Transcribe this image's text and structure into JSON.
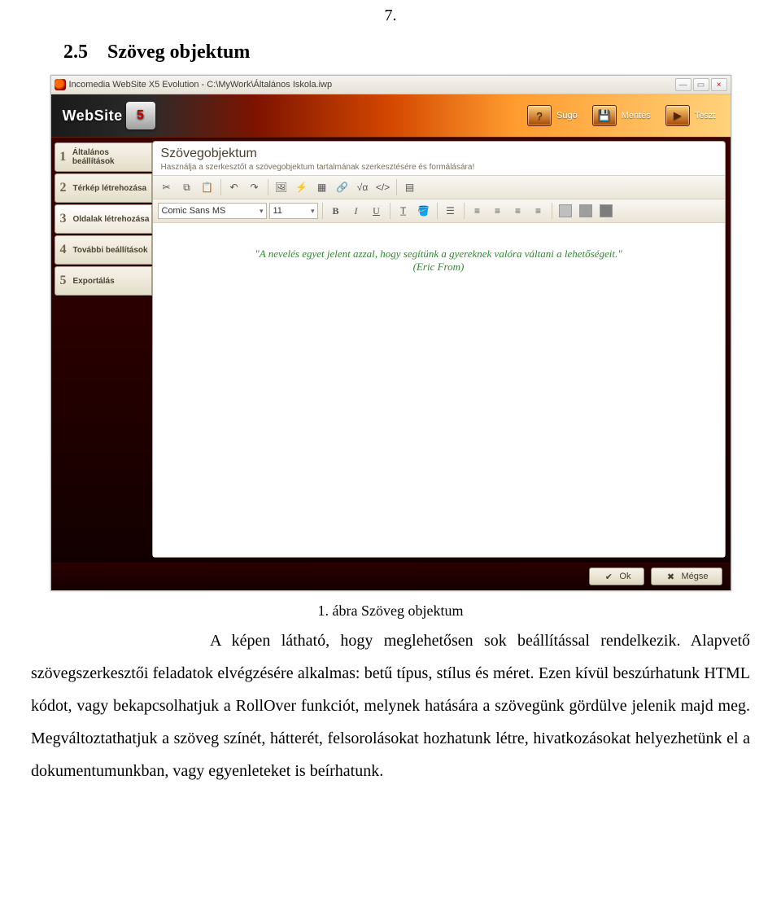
{
  "page_number": "7.",
  "section_number": "2.5",
  "section_title": "Szöveg objektum",
  "app": {
    "window_title": "Incomedia WebSite X5 Evolution - C:\\MyWork\\Általános Iskola.iwp",
    "logo_text": "WebSite",
    "logo_badge": "5",
    "header_buttons": {
      "help": {
        "label": "Súgó",
        "icon": "?"
      },
      "save": {
        "label": "Mentés",
        "icon": "💾"
      },
      "test": {
        "label": "Teszt",
        "icon": "▶"
      }
    },
    "sidebar": [
      {
        "num": "1",
        "label": "Általános beállítások"
      },
      {
        "num": "2",
        "label": "Térkép létrehozása"
      },
      {
        "num": "3",
        "label": "Oldalak létrehozása"
      },
      {
        "num": "4",
        "label": "További beállítások"
      },
      {
        "num": "5",
        "label": "Exportálás"
      }
    ],
    "panel": {
      "title": "Szövegobjektum",
      "subtitle": "Használja a szerkesztőt a szövegobjektum tartalmának szerkesztésére és formálására!"
    },
    "toolbar": {
      "font_name": "Comic Sans MS",
      "font_size": "11",
      "bold": "B",
      "italic": "I",
      "underline": "U",
      "html_btn": "</>"
    },
    "editor_text_line1": "\"A nevelés egyet jelent azzal, hogy segítünk a gyereknek valóra váltani a lehetőségeit.\"",
    "editor_text_line2": "(Eric From)",
    "footer": {
      "ok": "Ok",
      "cancel": "Mégse"
    }
  },
  "caption": "1. ábra Szöveg objektum",
  "paragraph": "A képen látható, hogy meglehetősen sok beállítással rendelkezik. Alapvető szövegszerkesztői feladatok elvégzésére alkalmas: betű típus, stílus és méret. Ezen kívül beszúrhatunk HTML kódot, vagy bekapcsolhatjuk a RollOver funkciót, melynek hatására a szövegünk gördülve jelenik majd meg. Megváltoztathatjuk a szöveg színét, hátterét, felsorolásokat hozhatunk létre, hivatkozásokat helyezhetünk el a dokumentumunkban, vagy egyenleteket is beírhatunk."
}
